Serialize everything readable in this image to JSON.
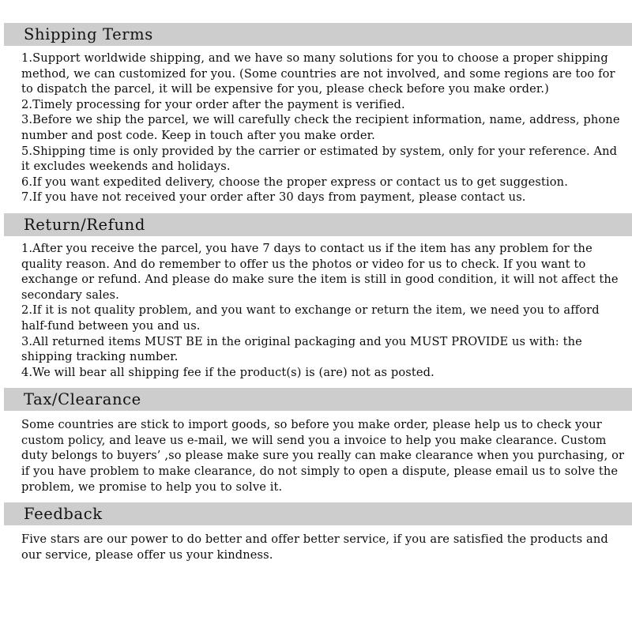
{
  "theme": {
    "page_background": "#ffffff",
    "header_band_color": "#cdcdcd",
    "text_color": "#0d0d0d"
  },
  "sections": [
    {
      "id": "shipping-terms",
      "title": "Shipping Terms",
      "body": "1.Support worldwide shipping, and we have so many solutions for you to choose a proper shipping method, we can customized for you. (Some countries are not involved, and some regions are too for to dispatch the parcel, it will be expensive for you, please check before you make order.)\n2.Timely processing for your order after the payment is verified.\n3.Before we ship the parcel, we will carefully check the recipient information, name, address, phone number and post code. Keep in touch after you make order.\n5.Shipping time is only provided by the carrier or estimated by system, only for your reference. And it excludes weekends and holidays.\n6.If you want expedited delivery, choose the proper express or contact us to get suggestion.\n7.If you have not received your order after 30 days from payment, please contact us."
    },
    {
      "id": "return-refund",
      "title": "Return/Refund",
      "body": "1.After you receive the parcel, you have 7 days to contact us if the item has any problem for the quality reason. And do remember to offer us the photos or video for us to check. If you want to exchange or refund. And please do make sure the item is still in good condition, it will not affect the secondary sales.\n2.If it is not quality problem, and you want to exchange or return the item, we need you to afford half-fund between you and us.\n3.All returned items MUST BE in the original packaging and you MUST PROVIDE us with: the shipping tracking number.\n4.We will bear all shipping fee if the product(s) is (are) not as posted."
    },
    {
      "id": "tax-clearance",
      "title": "Tax/Clearance",
      "body": "Some countries are stick to import goods, so before you make order, please help us to check your custom policy, and leave us e-mail, we will send you a invoice to help you make clearance. Custom duty belongs to buyers’ ,so please make sure you really can make clearance when you purchasing, or if you have problem to make clearance, do not simply to open a dispute, please email us to solve the problem, we promise to help you to solve it."
    },
    {
      "id": "feedback",
      "title": "Feedback",
      "body": "Five stars are our power to do better and offer better service, if you are satisfied the products and our service, please offer us your kindness."
    }
  ]
}
